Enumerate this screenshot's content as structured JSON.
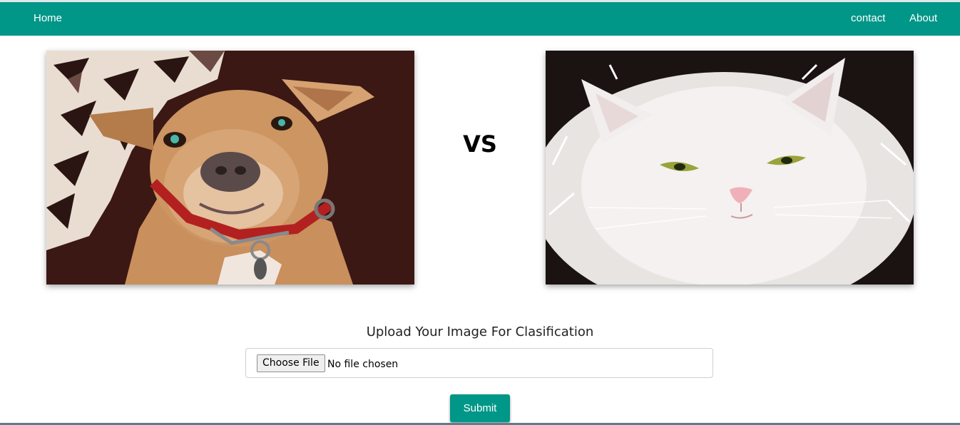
{
  "nav": {
    "home": "Home",
    "contact": "contact",
    "about": "About"
  },
  "colors": {
    "accent": "#009688",
    "page_background": "#ffffff"
  },
  "comparison": {
    "left_image": "dog-photo",
    "vs": "VS",
    "right_image": "cat-photo"
  },
  "upload": {
    "heading": "Upload Your Image For Clasification",
    "choose_button": "Choose File",
    "file_status": "No file chosen",
    "submit": "Submit"
  }
}
